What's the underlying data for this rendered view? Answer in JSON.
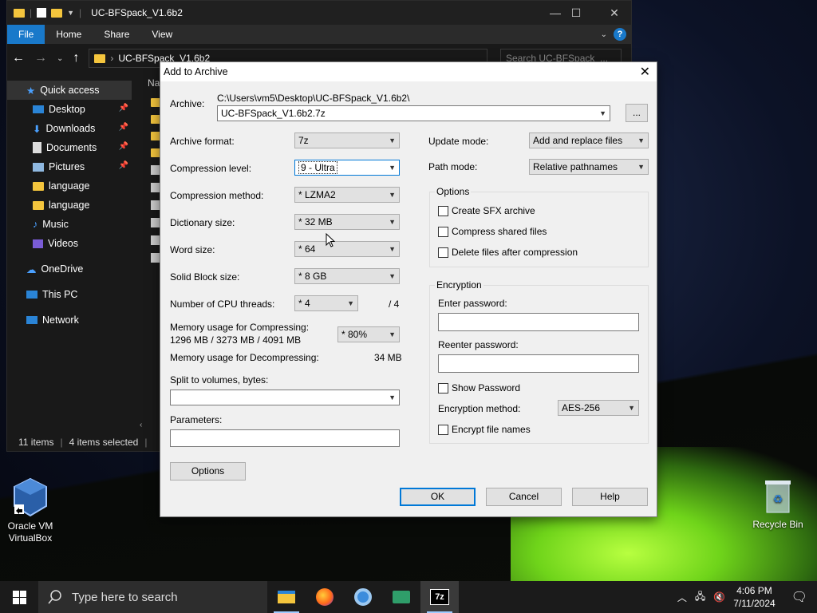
{
  "explorer": {
    "title": "UC-BFSpack_V1.6b2",
    "tabs": [
      "File",
      "Home",
      "Share",
      "View"
    ],
    "address": "UC-BFSpack_V1.6b2",
    "search_placeholder": "Search UC-BFSpack_...",
    "column_header": "Na",
    "nav": [
      {
        "label": "Quick access",
        "icon": "star-icon"
      },
      {
        "label": "Desktop",
        "icon": "desktop-icon",
        "pinned": true
      },
      {
        "label": "Downloads",
        "icon": "download-icon",
        "pinned": true
      },
      {
        "label": "Documents",
        "icon": "documents-icon",
        "pinned": true
      },
      {
        "label": "Pictures",
        "icon": "pictures-icon",
        "pinned": true
      },
      {
        "label": "language",
        "icon": "folder-icon"
      },
      {
        "label": "language",
        "icon": "folder-icon"
      },
      {
        "label": "Music",
        "icon": "music-icon"
      },
      {
        "label": "Videos",
        "icon": "videos-icon"
      },
      {
        "label": "OneDrive",
        "icon": "cloud-icon"
      },
      {
        "label": "This PC",
        "icon": "pc-icon"
      },
      {
        "label": "Network",
        "icon": "network-icon"
      }
    ],
    "status_items": "11 items",
    "status_selected": "4 items selected"
  },
  "dialog": {
    "title": "Add to Archive",
    "archive_label": "Archive:",
    "archive_path": "C:\\Users\\vm5\\Desktop\\UC-BFSpack_V1.6b2\\",
    "archive_name": "UC-BFSpack_V1.6b2.7z",
    "browse_label": "...",
    "fields": {
      "format_label": "Archive format:",
      "format_value": "7z",
      "level_label": "Compression level:",
      "level_value": "9 - Ultra",
      "method_label": "Compression method:",
      "method_value": "* LZMA2",
      "dict_label": "Dictionary size:",
      "dict_value": "* 32 MB",
      "word_label": "Word size:",
      "word_value": "* 64",
      "block_label": "Solid Block size:",
      "block_value": "* 8 GB",
      "threads_label": "Number of CPU threads:",
      "threads_value": "* 4",
      "threads_total": "/ 4",
      "mem_comp_label": "Memory usage for Compressing:",
      "mem_comp_value": "1296 MB / 3273 MB / 4091 MB",
      "mem_pct": "* 80%",
      "mem_decomp_label": "Memory usage for Decompressing:",
      "mem_decomp_value": "34 MB",
      "split_label": "Split to volumes, bytes:",
      "params_label": "Parameters:",
      "update_label": "Update mode:",
      "update_value": "Add and replace files",
      "path_label": "Path mode:",
      "path_value": "Relative pathnames"
    },
    "options_group": "Options",
    "options": [
      "Create SFX archive",
      "Compress shared files",
      "Delete files after compression"
    ],
    "encryption_group": "Encryption",
    "enter_pw_label": "Enter password:",
    "reenter_pw_label": "Reenter password:",
    "show_pw_label": "Show Password",
    "enc_method_label": "Encryption method:",
    "enc_method_value": "AES-256",
    "enc_names_label": "Encrypt file names",
    "options_button": "Options",
    "ok": "OK",
    "cancel": "Cancel",
    "help": "Help"
  },
  "desktop": {
    "vbox_label": "Oracle VM VirtualBox",
    "recycle_label": "Recycle Bin"
  },
  "taskbar": {
    "search_placeholder": "Type here to search",
    "time": "4:06 PM",
    "date": "7/11/2024",
    "apps": [
      "file-explorer-icon",
      "firefox-icon",
      "chrome-icon",
      "app-icon",
      "7zip-icon"
    ]
  }
}
